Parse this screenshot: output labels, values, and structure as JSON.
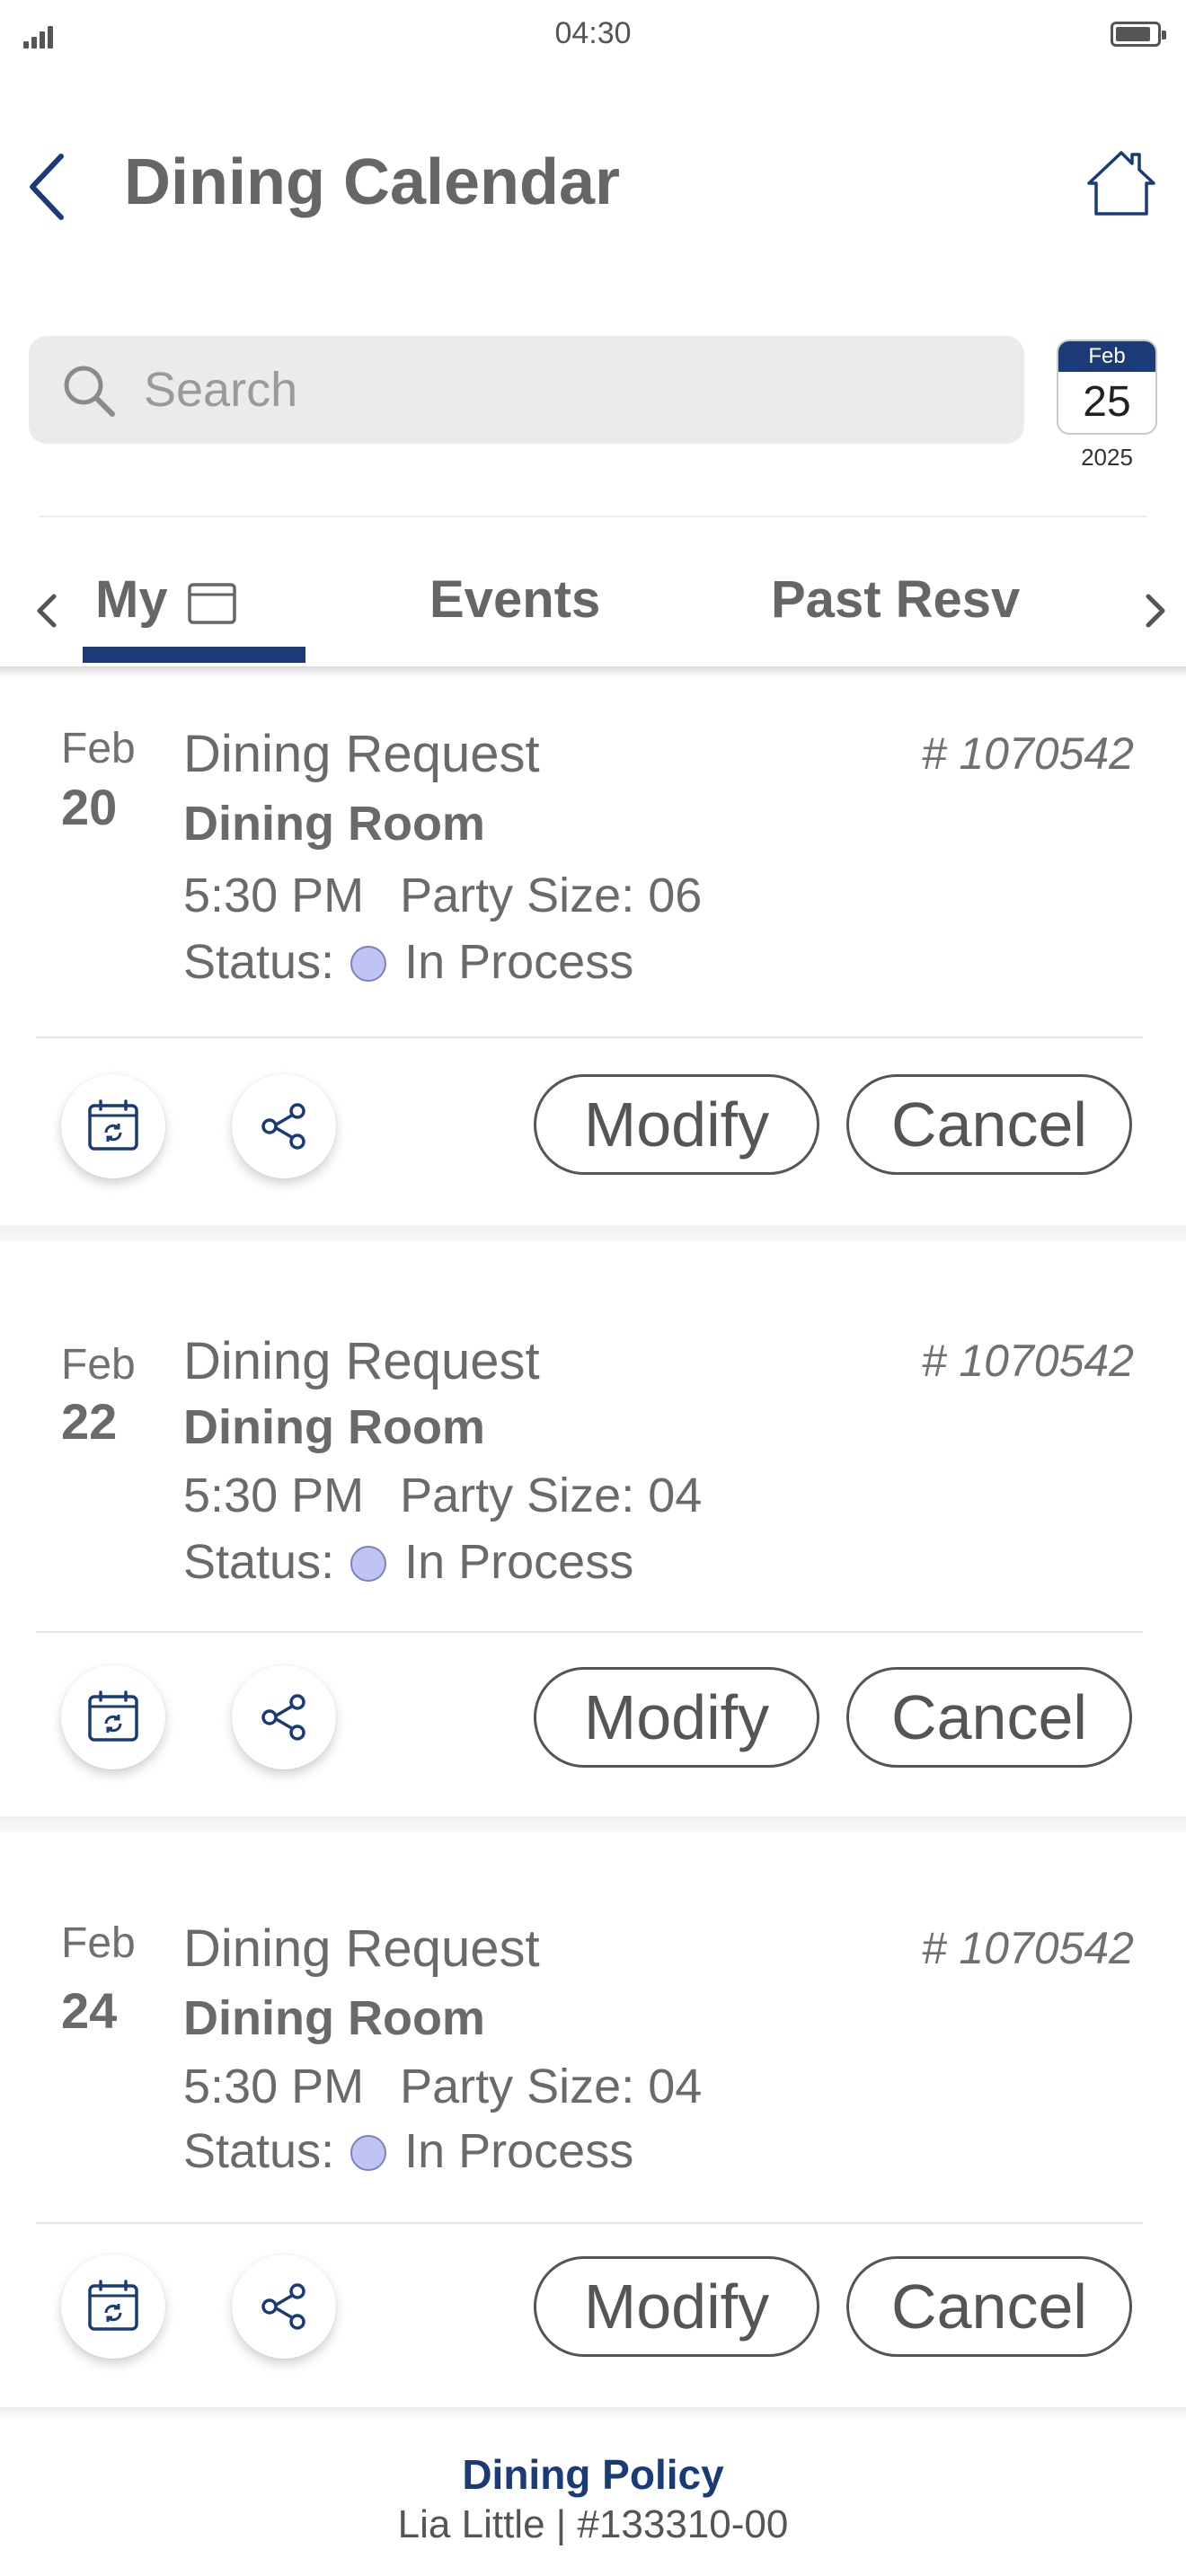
{
  "status_bar": {
    "time": "04:30"
  },
  "header": {
    "title": "Dining Calendar"
  },
  "search": {
    "placeholder": "Search"
  },
  "date_badge": {
    "month": "Feb",
    "day": "25",
    "year": "2025"
  },
  "tabs": {
    "my": "My",
    "events": "Events",
    "past": "Past Resv"
  },
  "reservations": [
    {
      "month": "Feb",
      "day": "20",
      "title": "Dining Request",
      "number": "# 1070542",
      "location": "Dining Room",
      "time": "5:30 PM",
      "party": "Party Size: 06",
      "status_label": "Status:",
      "status": "In Process",
      "modify": "Modify",
      "cancel": "Cancel"
    },
    {
      "month": "Feb",
      "day": "22",
      "title": "Dining Request",
      "number": "# 1070542",
      "location": "Dining Room",
      "time": "5:30 PM",
      "party": "Party Size: 04",
      "status_label": "Status:",
      "status": "In Process",
      "modify": "Modify",
      "cancel": "Cancel"
    },
    {
      "month": "Feb",
      "day": "24",
      "title": "Dining Request",
      "number": "# 1070542",
      "location": "Dining Room",
      "time": "5:30 PM",
      "party": "Party Size: 04",
      "status_label": "Status:",
      "status": "In Process",
      "modify": "Modify",
      "cancel": "Cancel"
    }
  ],
  "footer": {
    "policy": "Dining Policy",
    "member": "Lia Little | #133310-00"
  },
  "colors": {
    "brand": "#1a3a78",
    "status_dot": "#c0c4f2"
  }
}
